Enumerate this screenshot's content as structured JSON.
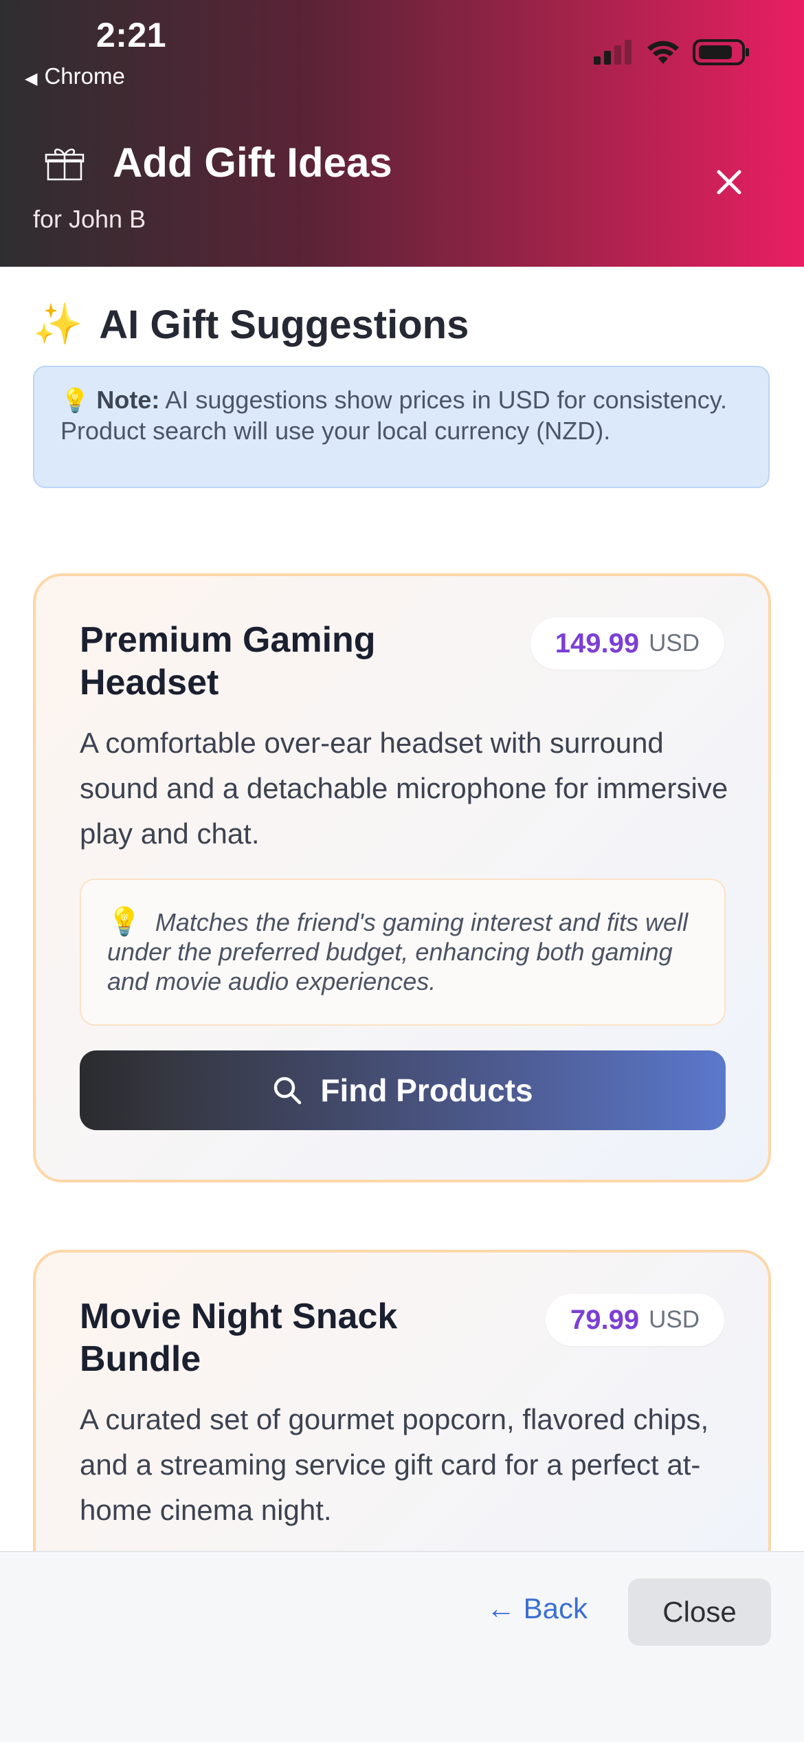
{
  "status_bar": {
    "time": "2:21",
    "back_app": "Chrome"
  },
  "header": {
    "title": "Add Gift Ideas",
    "subtitle": "for John B",
    "gradient_colors": [
      "#2e2e30",
      "#e91e63"
    ]
  },
  "section": {
    "title": "AI Gift Suggestions",
    "sparkle_icon": "✨"
  },
  "note": {
    "bulb_icon": "💡",
    "label": "Note:",
    "text": " AI suggestions show prices in USD for consistency. Product search will use your local currency (NZD)."
  },
  "suggestions": [
    {
      "title": "Premium Gaming Headset",
      "price": "149.99",
      "currency": "USD",
      "description": "A comfortable over-ear headset with surround sound and a detachable microphone for immersive play and chat.",
      "reason": "Matches the friend's gaming interest and fits well under the preferred budget, enhancing both gaming and movie audio experiences.",
      "button_label": "Find Products"
    },
    {
      "title": "Movie Night Snack Bundle",
      "price": "79.99",
      "currency": "USD",
      "description": "A curated set of gourmet popcorn, flavored chips, and a streaming service gift card for a perfect at-home cinema night."
    }
  ],
  "footer": {
    "back_label": "← Back",
    "close_label": "Close"
  },
  "colors": {
    "accent_price": "#7c3fd4",
    "link": "#3b6fd1",
    "card_border": "#fdd7a8"
  }
}
